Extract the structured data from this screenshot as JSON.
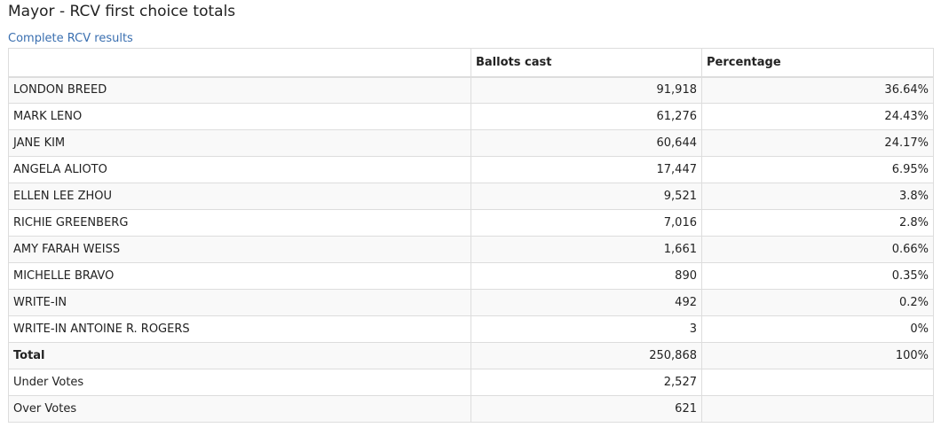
{
  "page": {
    "title": "Mayor - RCV first choice totals",
    "link_label": "Complete RCV results"
  },
  "table": {
    "headers": [
      "",
      "Ballots cast",
      "Percentage"
    ],
    "rows": [
      {
        "name": "LONDON BREED",
        "ballots": "91,918",
        "pct": "36.64%"
      },
      {
        "name": "MARK LENO",
        "ballots": "61,276",
        "pct": "24.43%"
      },
      {
        "name": "JANE KIM",
        "ballots": "60,644",
        "pct": "24.17%"
      },
      {
        "name": "ANGELA ALIOTO",
        "ballots": "17,447",
        "pct": "6.95%"
      },
      {
        "name": "ELLEN LEE ZHOU",
        "ballots": "9,521",
        "pct": "3.8%"
      },
      {
        "name": "RICHIE GREENBERG",
        "ballots": "7,016",
        "pct": "2.8%"
      },
      {
        "name": "AMY FARAH WEISS",
        "ballots": "1,661",
        "pct": "0.66%"
      },
      {
        "name": "MICHELLE BRAVO",
        "ballots": "890",
        "pct": "0.35%"
      },
      {
        "name": "WRITE-IN",
        "ballots": "492",
        "pct": "0.2%"
      },
      {
        "name": "WRITE-IN ANTOINE R. ROGERS",
        "ballots": "3",
        "pct": "0%"
      },
      {
        "name": "Total",
        "ballots": "250,868",
        "pct": "100%"
      },
      {
        "name": "Under Votes",
        "ballots": "2,527",
        "pct": ""
      },
      {
        "name": "Over Votes",
        "ballots": "621",
        "pct": ""
      }
    ]
  },
  "colors": {
    "link": "#3a6fb0",
    "row_stripe": "#f9f9f9",
    "border": "#dddddd"
  }
}
